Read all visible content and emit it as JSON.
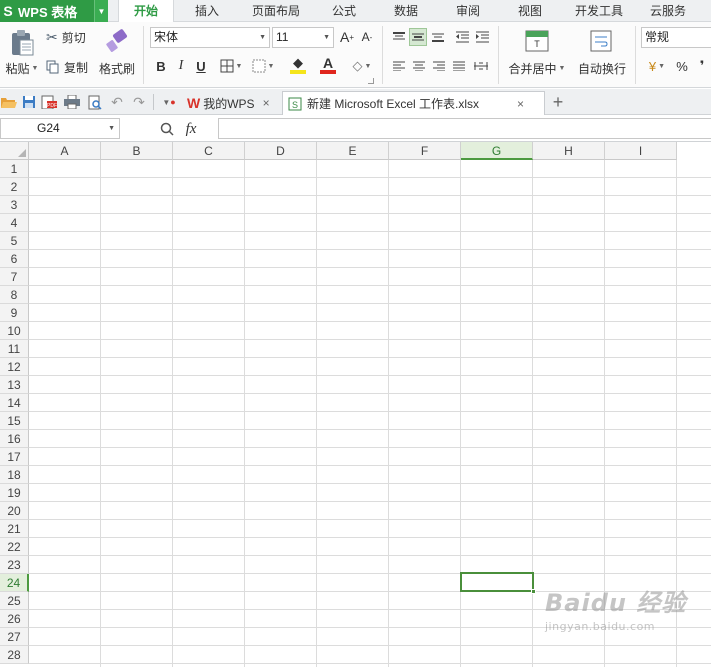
{
  "app": {
    "brand": "WPS 表格",
    "brand_logo": "S"
  },
  "menu_tabs": [
    {
      "label": "开始",
      "active": true
    },
    {
      "label": "插入"
    },
    {
      "label": "页面布局"
    },
    {
      "label": "公式"
    },
    {
      "label": "数据"
    },
    {
      "label": "审阅"
    },
    {
      "label": "视图"
    },
    {
      "label": "开发工具"
    },
    {
      "label": "云服务"
    }
  ],
  "ribbon": {
    "paste_label": "粘贴",
    "cut_label": "剪切",
    "copy_label": "复制",
    "format_painter_label": "格式刷",
    "font_name": "宋体",
    "font_size": "11",
    "bold": "B",
    "italic": "I",
    "underline": "U",
    "merge_center_label": "合并居中",
    "wrap_text_label": "自动换行",
    "number_format": "常规",
    "percent": "%",
    "comma": "❜",
    "font_color": "#e0261e",
    "fill_color": "#f5e51b"
  },
  "doc_tabs": [
    {
      "label": "我的WPS",
      "close": "×"
    },
    {
      "label": "新建 Microsoft Excel 工作表.xlsx",
      "close": "×",
      "active": true
    }
  ],
  "new_tab": "+",
  "formula_bar": {
    "cell_ref": "G24",
    "fx_label": "fx",
    "formula": ""
  },
  "columns": [
    "A",
    "B",
    "C",
    "D",
    "E",
    "F",
    "G",
    "H",
    "I"
  ],
  "rows": [
    "1",
    "2",
    "3",
    "4",
    "5",
    "6",
    "7",
    "8",
    "9",
    "10",
    "11",
    "12",
    "13",
    "14",
    "15",
    "16",
    "17",
    "18",
    "19",
    "20",
    "21",
    "22",
    "23",
    "24",
    "25",
    "26",
    "27",
    "28"
  ],
  "selection": {
    "column": "G",
    "row": "24"
  },
  "watermark": {
    "main": "Baidu 经验",
    "sub": "jingyan.baidu.com"
  },
  "colors": {
    "brand_green": "#2f9b45",
    "selection_green": "#4a8f3b"
  }
}
